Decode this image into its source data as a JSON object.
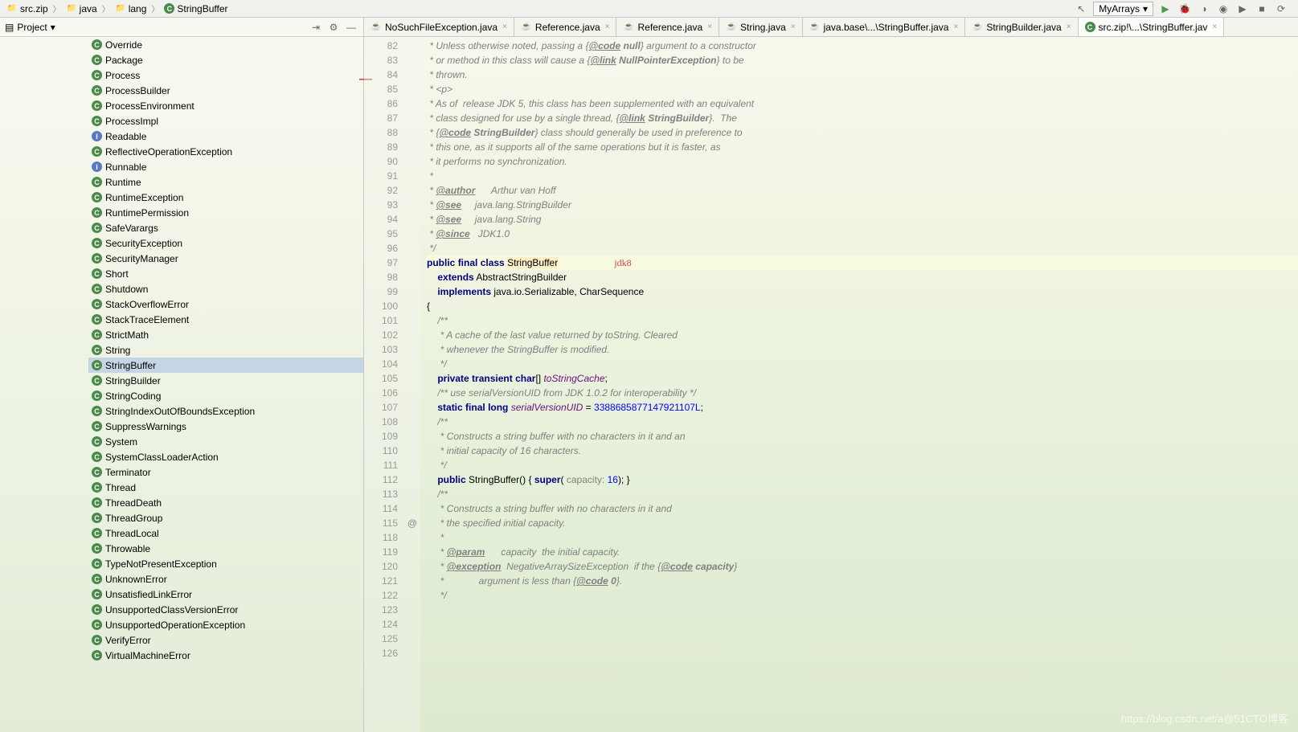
{
  "breadcrumb": [
    {
      "icon": "folder",
      "label": "src.zip"
    },
    {
      "icon": "folder",
      "label": "java"
    },
    {
      "icon": "folder",
      "label": "lang"
    },
    {
      "icon": "class",
      "label": "StringBuffer"
    }
  ],
  "run_config": "MyArrays",
  "sidebar_title": "Project",
  "tree_items": [
    {
      "icon": "C",
      "label": "Override"
    },
    {
      "icon": "C",
      "label": "Package"
    },
    {
      "icon": "C",
      "label": "Process"
    },
    {
      "icon": "C",
      "label": "ProcessBuilder"
    },
    {
      "icon": "C",
      "label": "ProcessEnvironment"
    },
    {
      "icon": "C",
      "label": "ProcessImpl"
    },
    {
      "icon": "I",
      "label": "Readable"
    },
    {
      "icon": "C",
      "label": "ReflectiveOperationException"
    },
    {
      "icon": "I",
      "label": "Runnable"
    },
    {
      "icon": "C",
      "label": "Runtime"
    },
    {
      "icon": "C",
      "label": "RuntimeException"
    },
    {
      "icon": "C",
      "label": "RuntimePermission"
    },
    {
      "icon": "C",
      "label": "SafeVarargs"
    },
    {
      "icon": "C",
      "label": "SecurityException"
    },
    {
      "icon": "C",
      "label": "SecurityManager"
    },
    {
      "icon": "C",
      "label": "Short"
    },
    {
      "icon": "C",
      "label": "Shutdown"
    },
    {
      "icon": "C",
      "label": "StackOverflowError"
    },
    {
      "icon": "C",
      "label": "StackTraceElement"
    },
    {
      "icon": "C",
      "label": "StrictMath"
    },
    {
      "icon": "C",
      "label": "String"
    },
    {
      "icon": "C",
      "label": "StringBuffer",
      "selected": true
    },
    {
      "icon": "C",
      "label": "StringBuilder"
    },
    {
      "icon": "C",
      "label": "StringCoding"
    },
    {
      "icon": "C",
      "label": "StringIndexOutOfBoundsException"
    },
    {
      "icon": "C",
      "label": "SuppressWarnings"
    },
    {
      "icon": "C",
      "label": "System"
    },
    {
      "icon": "C",
      "label": "SystemClassLoaderAction"
    },
    {
      "icon": "C",
      "label": "Terminator"
    },
    {
      "icon": "C",
      "label": "Thread"
    },
    {
      "icon": "C",
      "label": "ThreadDeath"
    },
    {
      "icon": "C",
      "label": "ThreadGroup"
    },
    {
      "icon": "C",
      "label": "ThreadLocal"
    },
    {
      "icon": "C",
      "label": "Throwable"
    },
    {
      "icon": "C",
      "label": "TypeNotPresentException"
    },
    {
      "icon": "C",
      "label": "UnknownError"
    },
    {
      "icon": "C",
      "label": "UnsatisfiedLinkError"
    },
    {
      "icon": "C",
      "label": "UnsupportedClassVersionError"
    },
    {
      "icon": "C",
      "label": "UnsupportedOperationException"
    },
    {
      "icon": "C",
      "label": "VerifyError"
    },
    {
      "icon": "C",
      "label": "VirtualMachineError"
    }
  ],
  "tabs": [
    {
      "icon": "java",
      "label": "NoSuchFileException.java"
    },
    {
      "icon": "java",
      "label": "Reference.java"
    },
    {
      "icon": "java",
      "label": "Reference.java"
    },
    {
      "icon": "java",
      "label": "String.java"
    },
    {
      "icon": "java",
      "label": "java.base\\...\\StringBuffer.java"
    },
    {
      "icon": "java",
      "label": "StringBuilder.java"
    },
    {
      "icon": "class",
      "label": "src.zip!\\...\\StringBuffer.jav",
      "active": true
    }
  ],
  "annotation": "jdk8",
  "line_start": 82,
  "line_end": 126,
  "gutter_marks": {
    "115": "@"
  },
  "watermark": "https://blog.csdn.net/a@51CTO博客",
  "code_lines": [
    " * Unless otherwise noted, passing a {@code null} argument to a constructor",
    " * or method in this class will cause a {@link NullPointerException} to be",
    " * thrown.",
    " * <p>",
    " * As of  release JDK 5, this class has been supplemented with an equivalent",
    " * class designed for use by a single thread, {@link StringBuilder}.  The",
    " * {@code StringBuilder} class should generally be used in preference to",
    " * this one, as it supports all of the same operations but it is faster, as",
    " * it performs no synchronization.",
    " *",
    " * @author      Arthur van Hoff",
    " * @see     java.lang.StringBuilder",
    " * @see     java.lang.String",
    " * @since   JDK1.0",
    " */",
    "public final class StringBuffer",
    "    extends AbstractStringBuilder",
    "    implements java.io.Serializable, CharSequence",
    "{",
    "",
    "    /**",
    "     * A cache of the last value returned by toString. Cleared",
    "     * whenever the StringBuffer is modified.",
    "     */",
    "    private transient char[] toStringCache;",
    "",
    "    /** use serialVersionUID from JDK 1.0.2 for interoperability */",
    "    static final long serialVersionUID = 3388685877147921107L;",
    "",
    "    /**",
    "     * Constructs a string buffer with no characters in it and an",
    "     * initial capacity of 16 characters.",
    "     */",
    "    public StringBuffer() { super( capacity: 16); }",
    "",
    "    /**",
    "     * Constructs a string buffer with no characters in it and",
    "     * the specified initial capacity.",
    "     *",
    "     * @param      capacity  the initial capacity.",
    "     * @exception  NegativeArraySizeException  if the {@code capacity}",
    "     *             argument is less than {@code 0}.",
    "     */"
  ]
}
